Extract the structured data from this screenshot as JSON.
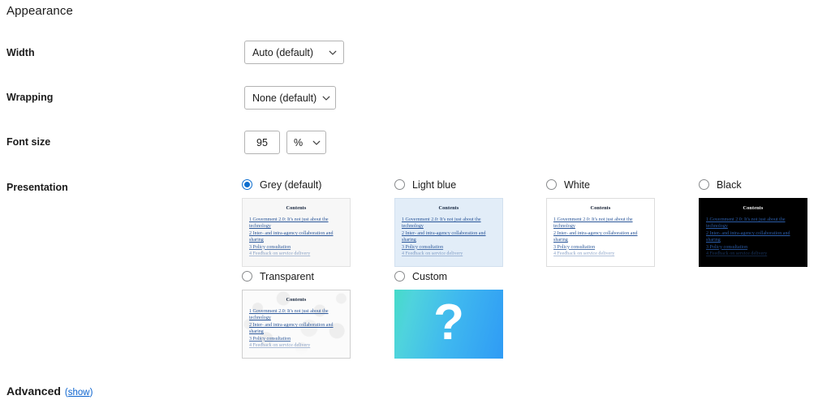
{
  "section": {
    "heading": "Appearance"
  },
  "fields": {
    "width": {
      "label": "Width",
      "selected": "Auto (default)",
      "options": [
        "Auto (default)"
      ]
    },
    "wrapping": {
      "label": "Wrapping",
      "selected": "None (default)",
      "options": [
        "None (default)"
      ]
    },
    "font_size": {
      "label": "Font size",
      "value": "95",
      "unit_selected": "%",
      "unit_options": [
        "%"
      ]
    },
    "presentation": {
      "label": "Presentation"
    }
  },
  "presentation_options": [
    {
      "id": "grey",
      "label": "Grey (default)",
      "selected": true,
      "preview": {
        "kind": "toc",
        "background": "#f7f7f7",
        "title": "Contents",
        "lines": [
          "1 Government 2.0: It's not just about the technology",
          "2 Inter- and intra-agency collaboration and sharing",
          "3 Policy consultation",
          "4 Feedback on service delivery"
        ]
      }
    },
    {
      "id": "lightblue",
      "label": "Light blue",
      "selected": false,
      "preview": {
        "kind": "toc",
        "background": "#e2edf8",
        "title": "Contents",
        "lines": [
          "1 Government 2.0: It's not just about the technology",
          "2 Inter- and intra-agency collaboration and sharing",
          "3 Policy consultation",
          "4 Feedback on service delivery"
        ]
      }
    },
    {
      "id": "white",
      "label": "White",
      "selected": false,
      "preview": {
        "kind": "toc",
        "background": "#ffffff",
        "title": "Contents",
        "lines": [
          "1 Government 2.0: It's not just about the technology",
          "2 Inter- and intra-agency collaboration and sharing",
          "3 Policy consultation",
          "4 Feedback on service delivery"
        ]
      }
    },
    {
      "id": "black",
      "label": "Black",
      "selected": false,
      "preview": {
        "kind": "toc",
        "background": "#000000",
        "title": "Contents",
        "lines": [
          "1 Government 2.0: It's not just about the technology",
          "2 Inter- and intra-agency collaboration and sharing",
          "3 Policy consultation",
          "4 Feedback on service delivery"
        ]
      }
    },
    {
      "id": "transparent",
      "label": "Transparent",
      "selected": false,
      "preview": {
        "kind": "toc",
        "background": "transparent-checker",
        "title": "Contents",
        "lines": [
          "1 Government 2.0: It's not just about the technology",
          "2 Inter- and intra-agency collaboration and sharing",
          "3 Policy consultation",
          "4 Feedback on service delivery"
        ]
      }
    },
    {
      "id": "custom",
      "label": "Custom",
      "selected": false,
      "preview": {
        "kind": "swatch",
        "glyph": "?",
        "gradient_from": "#45dbc8",
        "gradient_to": "#2f9bf5"
      }
    }
  ],
  "advanced": {
    "title": "Advanced",
    "open_paren": "(",
    "toggle_label": "show",
    "close_paren": ")"
  },
  "colors": {
    "accent": "#0d6ecf",
    "link": "#0b63ce",
    "text": "#1b1b1b",
    "border": "#b3b3b3",
    "toc_link": "#2a5699"
  }
}
